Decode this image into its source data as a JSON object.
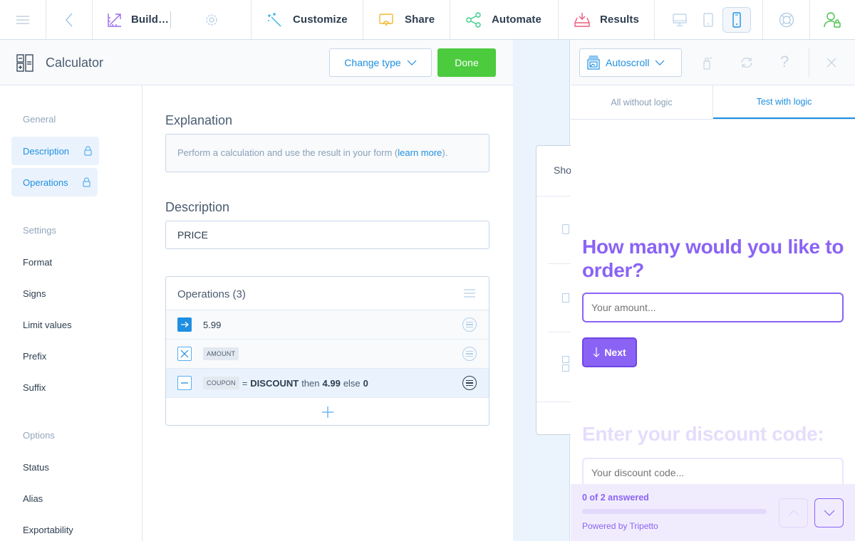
{
  "topbar": {
    "build_label": "Build…",
    "customize_label": "Customize",
    "share_label": "Share",
    "automate_label": "Automate",
    "results_label": "Results",
    "active_device": "phone",
    "icons": [
      "hamburger-menu-icon",
      "back-chevron-icon",
      "build-ruler-icon",
      "gear-icon",
      "magic-wand-icon",
      "share-screen-icon",
      "automate-nodes-icon",
      "results-tray-icon",
      "desktop-icon",
      "tablet-icon",
      "phone-icon",
      "help-lifebuoy-icon",
      "user-lock-icon"
    ]
  },
  "editor": {
    "block_type": "Calculator",
    "change_type_label": "Change type",
    "done_label": "Done"
  },
  "sidebar": {
    "groups": [
      {
        "label": "General",
        "items": [
          {
            "label": "Description",
            "locked": true
          },
          {
            "label": "Operations",
            "locked": true
          }
        ]
      },
      {
        "label": "Settings",
        "items": [
          {
            "label": "Format"
          },
          {
            "label": "Signs"
          },
          {
            "label": "Limit values"
          },
          {
            "label": "Prefix"
          },
          {
            "label": "Suffix"
          }
        ]
      },
      {
        "label": "Options",
        "items": [
          {
            "label": "Status"
          },
          {
            "label": "Alias"
          },
          {
            "label": "Exportability"
          }
        ]
      }
    ]
  },
  "main": {
    "explanation_title": "Explanation",
    "explanation_text": "Perform a calculation and use the result in your form (",
    "explanation_link": "learn more",
    "explanation_end": ").",
    "description_title": "Description",
    "description_value": "PRICE",
    "operations_title": "Operations (3)",
    "operations": [
      {
        "operator": "start",
        "value": "5.99"
      },
      {
        "operator": "multiply",
        "tag": "AMOUNT"
      },
      {
        "operator": "subtract",
        "tag": "COUPON",
        "eq": "=",
        "match": "DISCOUNT",
        "then": "then",
        "then_value": "4.99",
        "else": "else",
        "else_value": "0"
      }
    ]
  },
  "canvas": {
    "partial_text": "Sho"
  },
  "preview": {
    "mode_label": "Autoscroll",
    "tabs": [
      {
        "label": "All without logic",
        "active": false
      },
      {
        "label": "Test with logic",
        "active": true
      }
    ],
    "question1": "How many would you like to order?",
    "question1_placeholder": "Your amount...",
    "next_label": "Next",
    "question2": "Enter your discount code:",
    "question2_placeholder": "Your discount code...",
    "progress_text": "0 of 2 answered",
    "progress_fraction": 0,
    "powered_by": "Powered by Tripetto",
    "accent_color": "#8a63f5"
  }
}
